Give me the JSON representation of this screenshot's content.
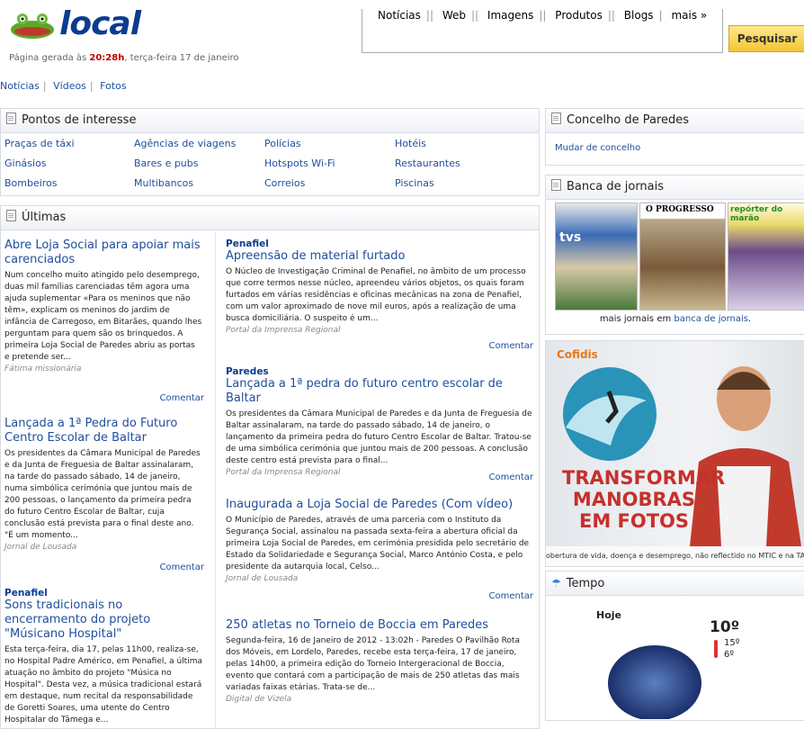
{
  "header": {
    "logo_text": "local",
    "generated_prefix": "Página gerada às ",
    "generated_time": "20:28h",
    "generated_suffix": ", terça-feira 17 de janeiro"
  },
  "search": {
    "tabs": [
      "Notícias",
      "Web",
      "Imagens",
      "Produtos",
      "Blogs",
      "mais »"
    ],
    "button_label": "Pesquisar"
  },
  "topnav": [
    "Notícias",
    "Vídeos",
    "Fotos"
  ],
  "poi": {
    "title": "Pontos de interesse",
    "columns": [
      [
        "Praças de táxi",
        "Ginásios",
        "Bombeiros"
      ],
      [
        "Agências de viagens",
        "Bares e pubs",
        "Multibancos"
      ],
      [
        "Polícias",
        "Hotspots Wi-Fi",
        "Correios"
      ],
      [
        "Hotéis",
        "Restaurantes",
        "Piscinas"
      ]
    ]
  },
  "ultimas": {
    "title": "Últimas",
    "comment_label": "Comentar",
    "left": [
      {
        "category": "",
        "title": "Abre Loja Social para apoiar mais carenciados",
        "body": "Num concelho muito atingido pelo desemprego, duas mil famílias carenciadas têm agora uma ajuda suplementar «Para os meninos que não têm», explicam os meninos do jardim de infância de Carregoso, em Bitarães, quando lhes perguntam para quem são os brinquedos. A primeira Loja Social de Paredes abriu as portas e pretende ser...",
        "source": "Fátima missionária"
      },
      {
        "category": "",
        "title": "Lançada a 1ª Pedra do Futuro Centro Escolar de Baltar",
        "body": "Os presidentes da Câmara Municipal de Paredes e da Junta de Freguesia de Baltar assinalaram, na tarde do passado sábado, 14 de janeiro, numa simbólica cerimónia que juntou mais de 200 pessoas, o lançamento da primeira pedra do futuro Centro Escolar de Baltar, cuja conclusão está prevista para o final deste ano. \"É um momento...",
        "source": "Jornal de Lousada"
      },
      {
        "category": "Penafiel",
        "title": "Sons tradicionais no encerramento do projeto \"Músicano Hospital\"",
        "body": "Esta terça-feira, dia 17, pelas 11h00, realiza-se, no Hospital Padre Américo, em Penafiel, a última atuação no âmbito do projeto \"Música no Hospital\". Desta vez, a música tradicional estará em destaque, num recital da responsabilidade de Goretti Soares, uma utente do Centro Hospitalar do Tâmega e...",
        "source": ""
      }
    ],
    "right": [
      {
        "category": "Penafiel",
        "title": "Apreensão de material furtado",
        "body": "O Núcleo de Investigação Criminal de Penafiel, no âmbito de um processo que corre termos nesse núcleo, apreendeu vários objetos, os quais foram furtados em várias residências e oficinas mecânicas na zona de Penafiel, com um valor aproximado de nove mil euros, após a realização de uma busca domiciliária. O suspeito é um...",
        "source": "Portal da Imprensa Regional"
      },
      {
        "category": "Paredes",
        "title": "Lançada a 1ª pedra do futuro centro escolar de Baltar",
        "body": "Os presidentes da Câmara Municipal de Paredes e da Junta de Freguesia de Baltar assinalaram, na tarde do passado sábado, 14 de janeiro, o lançamento da primeira pedra do futuro Centro Escolar de Baltar. Tratou-se de uma simbólica cerimónia que juntou mais de 200 pessoas. A conclusão deste centro está prevista para o final...",
        "source": "Portal da Imprensa Regional"
      },
      {
        "category": "",
        "title": "Inaugurada a Loja Social de Paredes (Com vídeo)",
        "body": "O Município de Paredes, através de uma parceria com o Instituto da Segurança Social, assinalou na passada sexta-feira a abertura oficial da primeira Loja Social de Paredes, em cerimónia presidida pelo secretário de Estado da Solidariedade e Segurança Social, Marco António Costa, e pelo presidente da autarquia local, Celso...",
        "source": "Jornal de Lousada"
      },
      {
        "category": "",
        "title": "250 atletas no Torneio de Boccia em Paredes",
        "body": "Segunda-feira, 16 de Janeiro de 2012 - 13:02h - Paredes O Pavilhão Rota dos Móveis, em Lordelo, Paredes, recebe esta terça-feira, 17 de janeiro, pelas 14h00, a primeira edição do Torneio Intergeracional de Boccia, evento que contará com a participação de mais de 250 atletas das mais variadas faixas etárias. Trata-se de...",
        "source": "Digital de Vizela"
      }
    ]
  },
  "concelho": {
    "title": "Concelho de Paredes",
    "link": "Mudar de concelho"
  },
  "banca": {
    "title": "Banca de jornais",
    "more_prefix": "mais jornais em ",
    "more_link": "banca de jornais",
    "more_suffix": ".",
    "covers": [
      {
        "name": "tvs",
        "color": "#3a6bb5"
      },
      {
        "name": "O PROGRESSO",
        "color": "#b8a88a"
      },
      {
        "name": "repórter do marão",
        "color": "#6c4c8a"
      }
    ]
  },
  "ad": {
    "brand": "Cofidis",
    "headline_1": "TRANSFORMAR",
    "headline_2": "MANOBRAS",
    "headline_3": "EM FOTOS",
    "footer": "obertura de vida, doença e desemprego, não reflectido no MTIC e na TAEG. \"Mon"
  },
  "tempo": {
    "title": "Tempo",
    "day": "Hoje",
    "temp": "10º",
    "max": "15º",
    "min": "6º"
  },
  "colors": {
    "link": "#1f4e9c",
    "highlight": "#c00000",
    "button": "#f3c534"
  }
}
